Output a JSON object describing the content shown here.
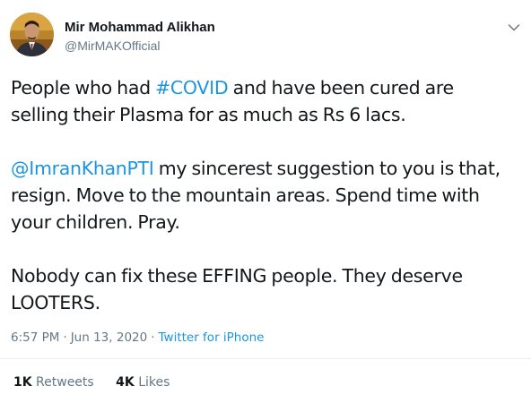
{
  "author": {
    "name": "Mir Mohammad Alikhan",
    "handle": "@MirMAKOfficial",
    "avatar_icon": "profile-photo-icon"
  },
  "menu_icon": "chevron-down-icon",
  "tweet": {
    "p1": {
      "l1_a": "People who had ",
      "l1_hashtag": "#COVID",
      "l1_b": " and have been cured are",
      "l2": "selling their Plasma for as much as Rs 6 lacs."
    },
    "p2": {
      "l1_mention": "@ImranKhanPTI",
      "l1_b": " my sincerest suggestion to you is that,",
      "l2": "resign. Move to the mountain areas. Spend time with",
      "l3": "your children. Pray."
    },
    "p3": {
      "l1": "Nobody can fix these EFFING people. They deserve",
      "l2": "LOOTERS."
    }
  },
  "meta": {
    "time": "6:57 PM",
    "separator": "·",
    "date": "Jun 13, 2020",
    "source": "Twitter for iPhone"
  },
  "stats": {
    "retweets_count": "1K",
    "retweets_label": "Retweets",
    "likes_count": "4K",
    "likes_label": "Likes"
  },
  "colors": {
    "link": "#1b95e0",
    "text": "#14171a",
    "secondary": "#657786",
    "divider": "#e6ecf0"
  }
}
